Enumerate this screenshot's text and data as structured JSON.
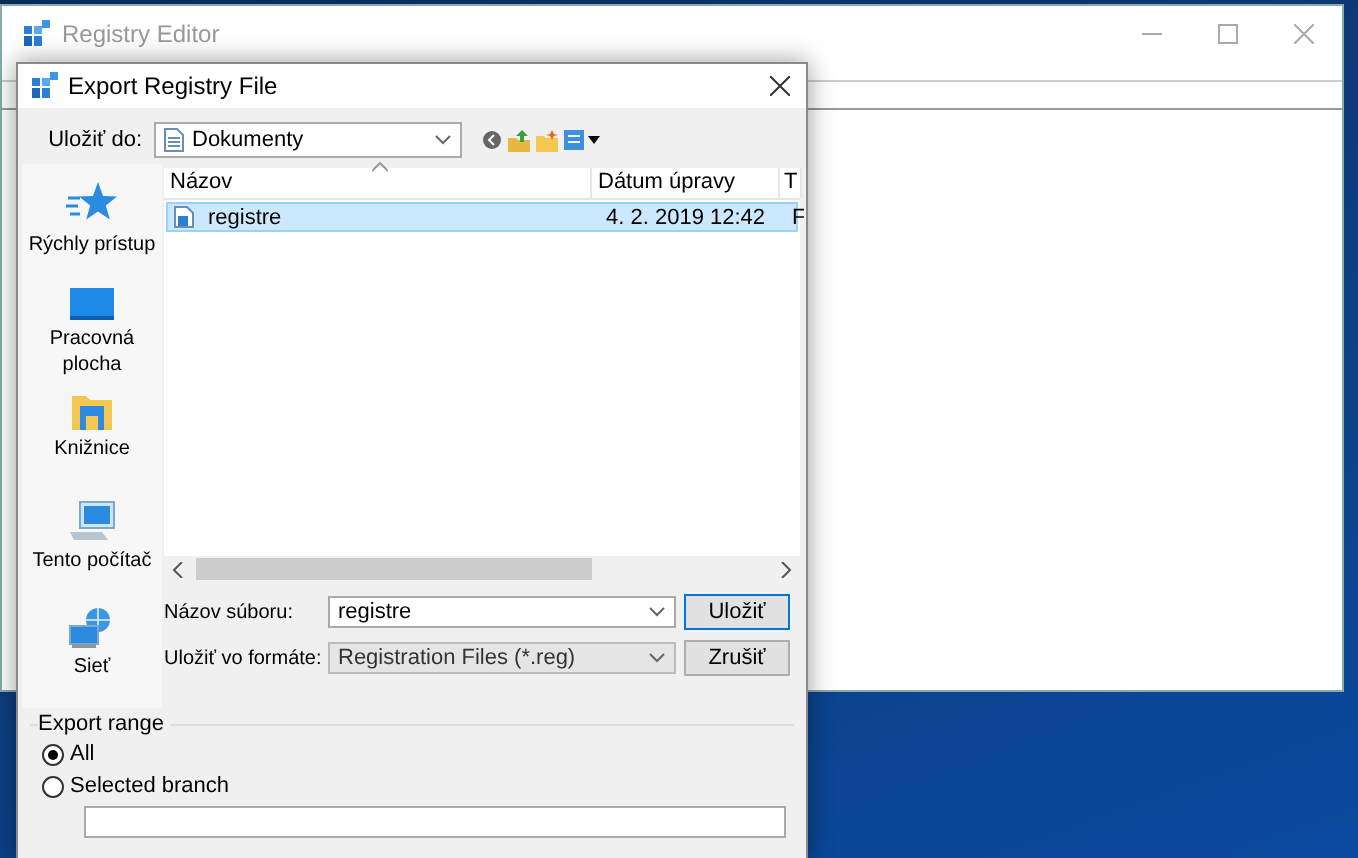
{
  "background_window": {
    "title": "Registry Editor"
  },
  "dialog": {
    "title": "Export Registry File",
    "save_in": {
      "label": "Uložiť do:",
      "value": "Dokumenty"
    },
    "places": [
      {
        "label": "Rýchly prístup",
        "kind": "star"
      },
      {
        "label": "Pracovná plocha",
        "kind": "desktop"
      },
      {
        "label": "Knižnice",
        "kind": "library"
      },
      {
        "label": "Tento počítač",
        "kind": "computer"
      },
      {
        "label": "Sieť",
        "kind": "network"
      }
    ],
    "file_list": {
      "columns": [
        "Názov",
        "Dátum úpravy",
        "T"
      ],
      "rows": [
        {
          "cells": [
            "registre",
            "4. 2. 2019 12:42",
            "F"
          ],
          "selected": true
        }
      ]
    },
    "file_name": {
      "label": "Názov súboru:",
      "value": "registre"
    },
    "file_type": {
      "label": "Uložiť vo formáte:",
      "value": "Registration Files (*.reg)"
    },
    "buttons": [
      "Uložiť",
      "Zrušiť"
    ],
    "export_range": {
      "title": "Export range",
      "options": [
        {
          "label": "All",
          "selected": true
        },
        {
          "label": "Selected branch",
          "selected": false
        }
      ]
    }
  }
}
